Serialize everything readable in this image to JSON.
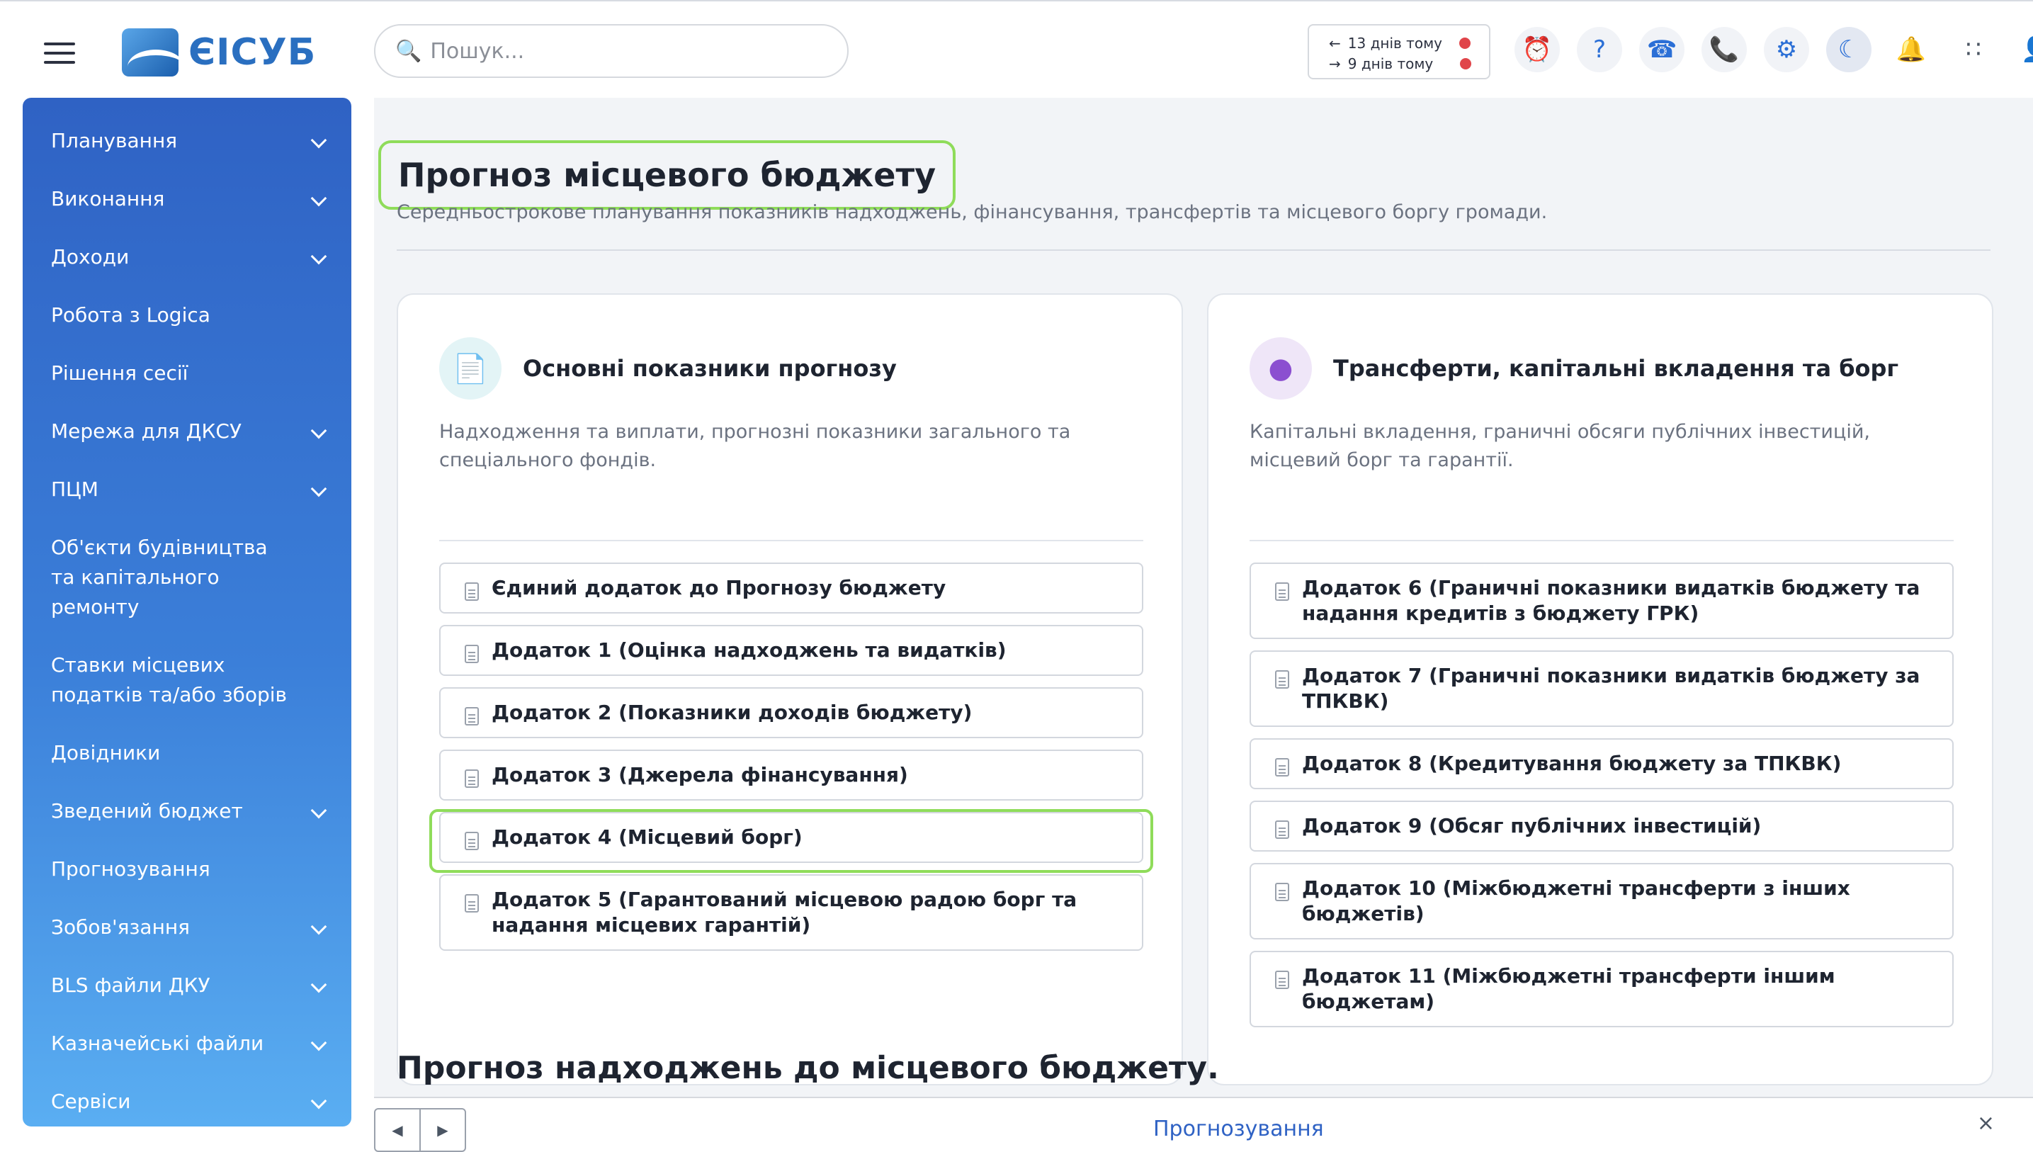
{
  "app": {
    "logo_text": "ЄІСУБ"
  },
  "search": {
    "placeholder": "Пошук..."
  },
  "history": {
    "back": "13 днів тому",
    "forward": "9 днів тому"
  },
  "toolbar_icons": [
    "alarm-clock-icon",
    "help-icon",
    "headset-icon",
    "phone-icon",
    "gear-icon",
    "moon-icon",
    "bell-icon",
    "apps-grid-icon",
    "user-icon"
  ],
  "sidebar": {
    "items": [
      {
        "label": "Планування",
        "expandable": true
      },
      {
        "label": "Виконання",
        "expandable": true
      },
      {
        "label": "Доходи",
        "expandable": true
      },
      {
        "label": "Робота з Logica",
        "expandable": false
      },
      {
        "label": "Рішення сесії",
        "expandable": false
      },
      {
        "label": "Мережа для ДКСУ",
        "expandable": true
      },
      {
        "label": "ПЦМ",
        "expandable": true
      },
      {
        "label": "Об'єкти будівництва та капітального ремонту",
        "expandable": false
      },
      {
        "label": "Ставки місцевих податків та/або зборів",
        "expandable": false
      },
      {
        "label": "Довідники",
        "expandable": false
      },
      {
        "label": "Зведений бюджет",
        "expandable": true
      },
      {
        "label": "Прогнозування",
        "expandable": false
      },
      {
        "label": "Зобов'язання",
        "expandable": true
      },
      {
        "label": "BLS файли ДКУ",
        "expandable": true
      },
      {
        "label": "Казначейські файли",
        "expandable": true
      },
      {
        "label": "Сервіси",
        "expandable": true
      }
    ]
  },
  "page": {
    "title": "Прогноз місцевого бюджету",
    "subtitle": "Середньострокове планування показників надходжень, фінансування, трансфертів та місцевого боргу громади.",
    "section2_title": "Прогноз надходжень до місцевого бюджету."
  },
  "cards": [
    {
      "title": "Основні показники прогнозу",
      "description": "Надходження та виплати, прогнозні показники загального та спеціального фондів.",
      "icon": "document-icon",
      "links": [
        "Єдиний додаток до Прогнозу бюджету",
        "Додаток 1 (Оцінка надходжень та видатків)",
        "Додаток 2 (Показники доходів бюджету)",
        "Додаток 3 (Джерела фінансування)",
        "Додаток 4 (Місцевий борг)",
        "Додаток 5 (Гарантований місцевою радою борг та надання місцевих гарантій)"
      ]
    },
    {
      "title": "Трансферти, капітальні вкладення та борг",
      "description": "Капітальні вкладення, граничні обсяги публічних інвестицій, місцевий борг та гарантії.",
      "icon": "coins-icon",
      "links": [
        "Додаток 6 (Граничні показники видатків бюджету та надання кредитів з бюджету ГРК)",
        "Додаток 7 (Граничні показники видатків бюджету за ТПКВК)",
        "Додаток 8 (Кредитування бюджету за ТПКВК)",
        "Додаток 9 (Обсяг публічних інвестицій)",
        "Додаток 10 (Міжбюджетні трансферти з інших бюджетів)",
        "Додаток 11 (Міжбюджетні трансферти іншим бюджетам)"
      ]
    }
  ],
  "bottom_bar": {
    "active_tab": "Прогнозування",
    "prev": "◀",
    "next": "▶",
    "close": "×"
  },
  "colors": {
    "accent": "#2f62c4",
    "highlight": "#8fdc5a",
    "sidebar_top": "#2f62c4",
    "sidebar_bottom": "#5aaef2"
  }
}
